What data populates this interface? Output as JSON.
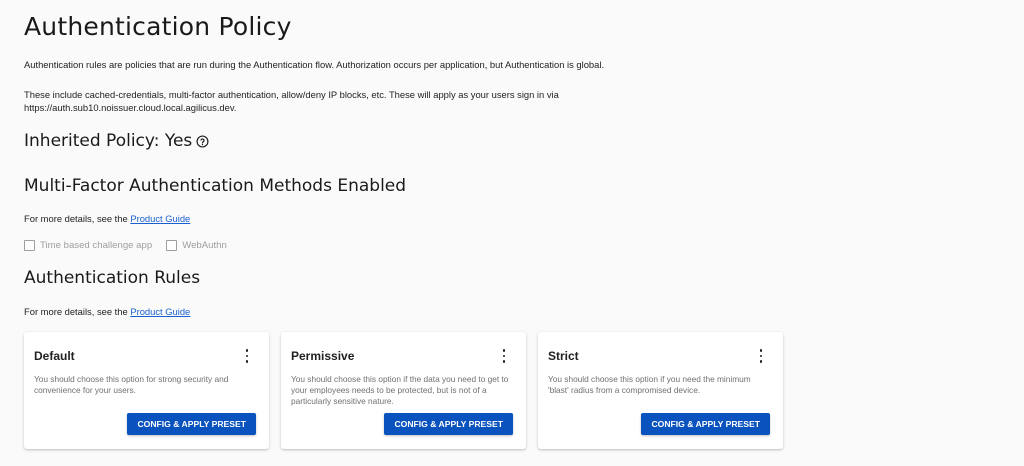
{
  "page": {
    "title": "Authentication Policy",
    "description_1": "Authentication rules are policies that are run during the Authentication flow. Authorization occurs per application, but Authentication is global.",
    "description_2": "These include cached-credentials, multi-factor authentication, allow/deny IP blocks, etc. These will apply as your users sign in via https://auth.sub10.noissuer.cloud.local.agilicus.dev."
  },
  "inherited": {
    "label": "Inherited Policy: Yes",
    "icon": "help-circle-icon"
  },
  "mfa": {
    "heading": "Multi-Factor Authentication Methods Enabled",
    "details_prefix": "For more details, see the ",
    "details_link": "Product Guide",
    "options": [
      {
        "label": "Time based challenge app",
        "checked": false
      },
      {
        "label": "WebAuthn",
        "checked": false
      }
    ]
  },
  "rules": {
    "heading": "Authentication Rules",
    "details_prefix": "For more details, see the ",
    "details_link": "Product Guide",
    "cards": [
      {
        "title": "Default",
        "description": "You should choose this option for strong security and convenience for your users.",
        "button": "CONFIG & APPLY PRESET"
      },
      {
        "title": "Permissive",
        "description": "You should choose this option if the data you need to get to your employees needs to be protected, but is not of a particularly sensitive nature.",
        "button": "CONFIG & APPLY PRESET"
      },
      {
        "title": "Strict",
        "description": "You should choose this option if you need the minimum 'blast' radius from a compromised device.",
        "button": "CONFIG & APPLY PRESET"
      }
    ]
  },
  "colors": {
    "primary_button": "#0a53be",
    "link": "#1a5fd0",
    "background": "#fafafa"
  }
}
